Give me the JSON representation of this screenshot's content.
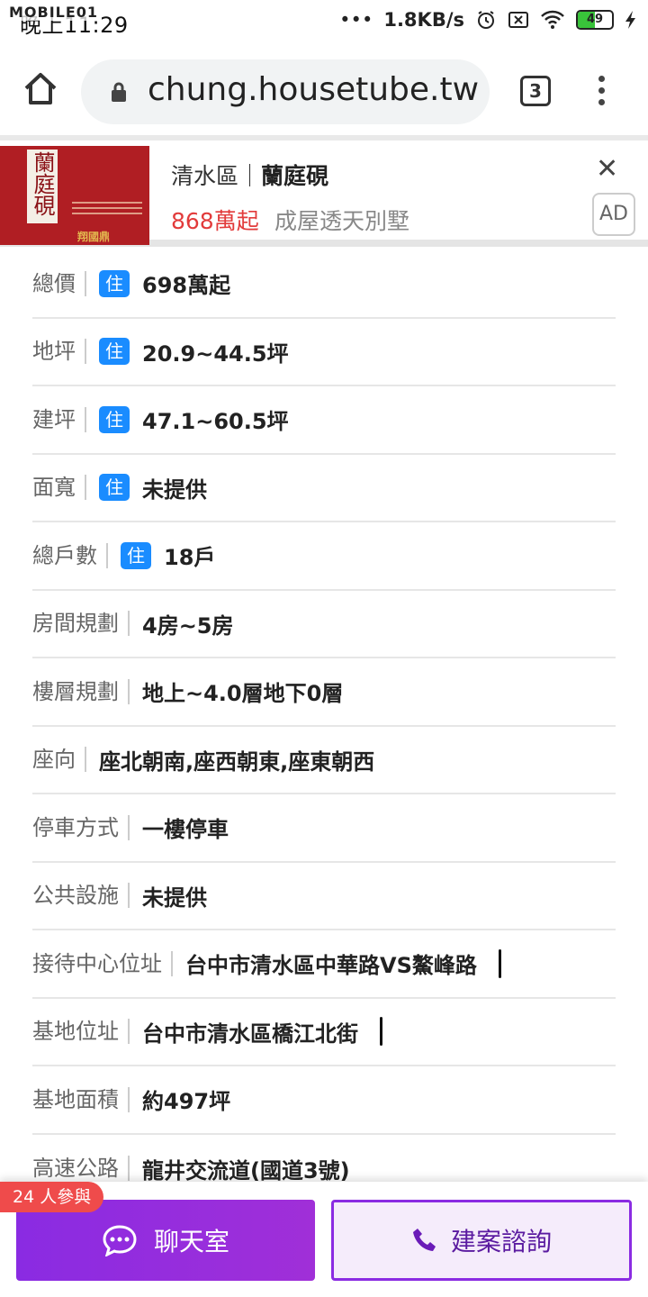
{
  "status_bar": {
    "time": "晚上11:29",
    "watermark": "MOBILE01",
    "network_speed": "1.8KB/s",
    "battery": "49",
    "battery_level": 0.49
  },
  "browser": {
    "url": "chung.housetube.tw",
    "tab_count": "3"
  },
  "ad": {
    "district": "清水區",
    "separator": "｜",
    "project_name": "蘭庭硯",
    "price": "868萬起",
    "type": "成屋透天別墅",
    "ad_label": "AD",
    "thumb_title": "蘭庭硯",
    "thumb_brand": "翔國鼎"
  },
  "details": [
    {
      "label": "總價",
      "tag": "住",
      "value": "698萬起"
    },
    {
      "label": "地坪",
      "tag": "住",
      "value": "20.9~44.5坪"
    },
    {
      "label": "建坪",
      "tag": "住",
      "value": "47.1~60.5坪"
    },
    {
      "label": "面寬",
      "tag": "住",
      "value": "未提供"
    },
    {
      "label": "總戶數",
      "tag": "住",
      "value": "18戶"
    },
    {
      "label": "房間規劃",
      "value": "4房~5房"
    },
    {
      "label": "樓層規劃",
      "value": "地上~4.0層地下0層"
    },
    {
      "label": "座向",
      "value": "座北朝南,座西朝東,座東朝西"
    },
    {
      "label": "停車方式",
      "value": "一樓停車"
    },
    {
      "label": "公共設施",
      "value": "未提供"
    },
    {
      "label": "接待中心位址",
      "value": "台中市清水區中華路VS鰲峰路"
    },
    {
      "label": "基地位址",
      "value": "台中市清水區橋江北街"
    },
    {
      "label": "基地面積",
      "value": "約497坪"
    },
    {
      "label": "高速公路",
      "value": "龍井交流道(國道3號)"
    }
  ],
  "bottom_bar": {
    "participants": "24 人參與",
    "chat_label": "聊天室",
    "inquiry_label": "建案諮詢"
  },
  "colors": {
    "accent_purple": "#8a2be2",
    "tag_blue": "#1a8cff",
    "price_red": "#e23b3b",
    "pill_red": "#ef4b4b"
  }
}
